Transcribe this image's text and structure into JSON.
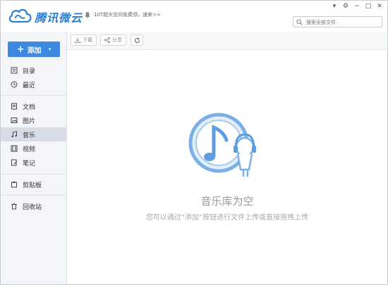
{
  "app": {
    "brand": "腾讯微云"
  },
  "notice": {
    "text": "10T超大空间免费领，速来>>"
  },
  "search": {
    "placeholder": "搜索全部文件"
  },
  "sidebar": {
    "add_label": "添加",
    "items": [
      {
        "label": "目录",
        "icon": "folder-list-icon"
      },
      {
        "label": "最近",
        "icon": "clock-icon"
      },
      {
        "label": "文档",
        "icon": "document-icon"
      },
      {
        "label": "图片",
        "icon": "image-icon"
      },
      {
        "label": "音乐",
        "icon": "music-note-icon",
        "active": true
      },
      {
        "label": "视频",
        "icon": "film-icon"
      },
      {
        "label": "笔记",
        "icon": "note-icon"
      },
      {
        "label": "剪贴板",
        "icon": "clipboard-icon"
      },
      {
        "label": "回收站",
        "icon": "trash-icon"
      }
    ]
  },
  "toolbar": {
    "download_label": "下载",
    "share_label": "分享"
  },
  "empty": {
    "title": "音乐库为空",
    "description": "您可以通过“添加”按钮进行文件上传或直接拖拽上传"
  },
  "colors": {
    "accent": "#3b8ae0",
    "sidebar_active": "#d7dde6"
  }
}
